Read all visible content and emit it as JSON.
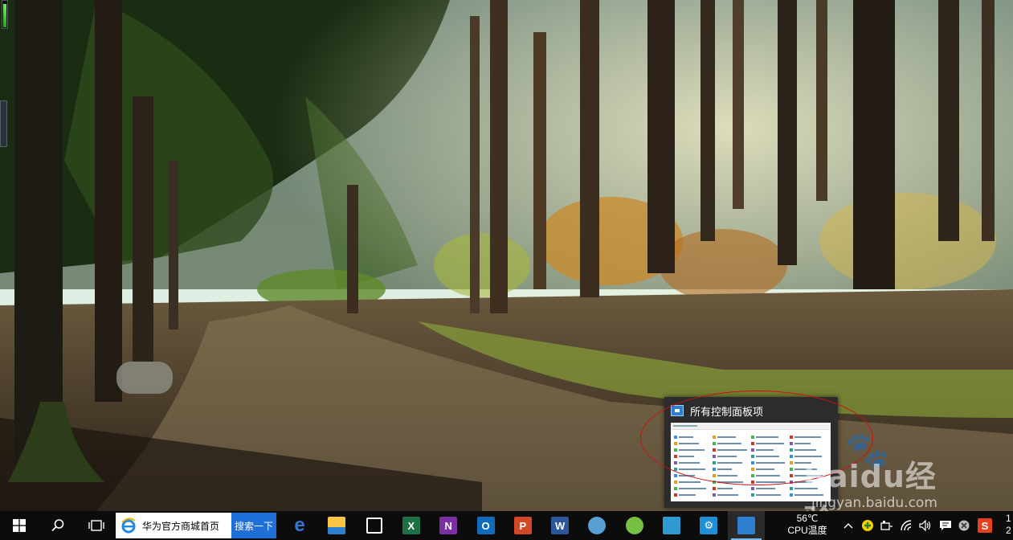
{
  "desktop": {
    "wallpaper": "sunlit forest path",
    "gauge_level": 0.85
  },
  "thumbnail": {
    "title": "所有控制面板项",
    "app_icon": "control-panel-icon"
  },
  "watermark": {
    "logo": "Baidu经验",
    "url": "jingyan.baidu.com"
  },
  "taskbar": {
    "start_icon": "windows-logo-icon",
    "search_icon": "search-icon",
    "taskview_icon": "task-view-icon",
    "ie_toolbar": {
      "text": "华为官方商城首页",
      "search_label": "搜索一下"
    },
    "apps": [
      {
        "name": "edge-icon",
        "color": "#3277d2"
      },
      {
        "name": "file-explorer-icon",
        "color": "#f7c542"
      },
      {
        "name": "store-icon",
        "color": "#ffffff"
      },
      {
        "name": "excel-icon",
        "color": "#1e7145"
      },
      {
        "name": "onenote-icon",
        "color": "#7a2fa0"
      },
      {
        "name": "outlook-icon",
        "color": "#0f6cbd"
      },
      {
        "name": "powerpoint-icon",
        "color": "#d24726"
      },
      {
        "name": "word-icon",
        "color": "#2b579a"
      },
      {
        "name": "paint-icon",
        "color": "#56a0d3"
      },
      {
        "name": "refresh-app-icon",
        "color": "#76c043"
      },
      {
        "name": "photos-app-icon",
        "color": "#2e9ad0"
      },
      {
        "name": "settings-icon",
        "color": "#1d8fd6"
      },
      {
        "name": "control-panel-icon",
        "color": "#2f7fd1"
      }
    ],
    "cpu": {
      "temp": "56℃",
      "label": "CPU温度"
    },
    "tray": {
      "chevron_icon": "chevron-up-icon",
      "icons": [
        "add-icon",
        "battery-icon",
        "wifi-icon",
        "volume-icon",
        "notifications-icon",
        "close-circle-icon",
        "sogou-icon"
      ]
    },
    "clock": {
      "line1": "1",
      "line2": "2"
    }
  },
  "colors": {
    "taskbar": "#0c0c0c",
    "annotation": "#d01010",
    "accent": "#1f6fd8"
  }
}
